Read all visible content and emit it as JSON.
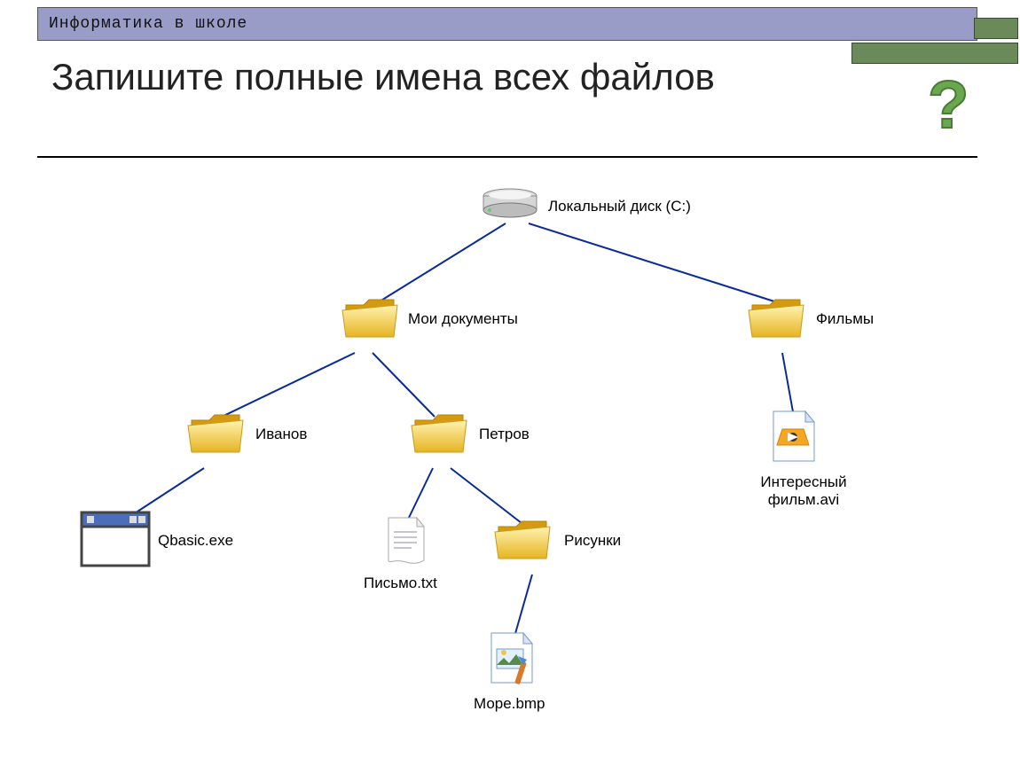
{
  "header": {
    "text": "Информатика в школе"
  },
  "title": "Запишите полные имена всех файлов",
  "tree": {
    "root": {
      "label": "Локальный диск (C:)"
    },
    "my_docs": {
      "label": "Мои документы"
    },
    "films": {
      "label": "Фильмы"
    },
    "ivanov": {
      "label": "Иванов"
    },
    "petrov": {
      "label": "Петров"
    },
    "qbasic": {
      "label": "Qbasic.exe"
    },
    "letter": {
      "label": "Письмо.txt"
    },
    "pictures": {
      "label": "Рисунки"
    },
    "sea": {
      "label": "Море.bmp"
    },
    "movie": {
      "label": "Интересный фильм.avi"
    }
  }
}
